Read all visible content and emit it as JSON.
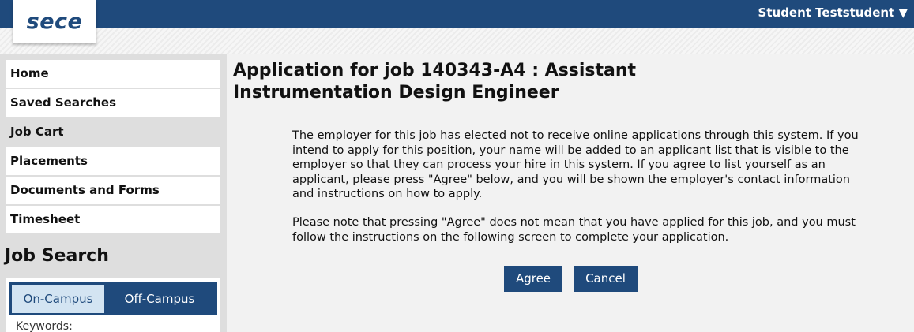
{
  "header": {
    "logo_text": "sece",
    "user_menu": "Student Teststudent ▼"
  },
  "sidebar": {
    "items": [
      {
        "label": "Home"
      },
      {
        "label": "Saved Searches"
      },
      {
        "label": "Job Cart"
      },
      {
        "label": "Placements"
      },
      {
        "label": "Documents and Forms"
      },
      {
        "label": "Timesheet"
      }
    ],
    "active_item": "Job Cart",
    "job_search": {
      "heading": "Job Search",
      "tabs": [
        {
          "label": "On-Campus",
          "selected": true
        },
        {
          "label": "Off-Campus",
          "selected": false
        }
      ],
      "keywords_label": "Keywords:"
    }
  },
  "main": {
    "title": "Application for job 140343-A4 : Assistant Instrumentation Design Engineer",
    "paragraph1": "The employer for this job has elected not to receive online applications through this system. If you intend to apply for this position, your name will be added to an applicant list that is visible to the employer so that they can process your hire in this system. If you agree to list yourself as an applicant, please press \"Agree\" below, and you will be shown the employer's contact information and instructions on how to apply.",
    "paragraph2": "Please note that pressing \"Agree\" does not mean that you have applied for this job, and you must follow the instructions on the following screen to complete your application.",
    "agree_label": "Agree",
    "cancel_label": "Cancel"
  },
  "colors": {
    "brand": "#1f4a7c",
    "tab_selected_bg": "#d3e4f2"
  }
}
